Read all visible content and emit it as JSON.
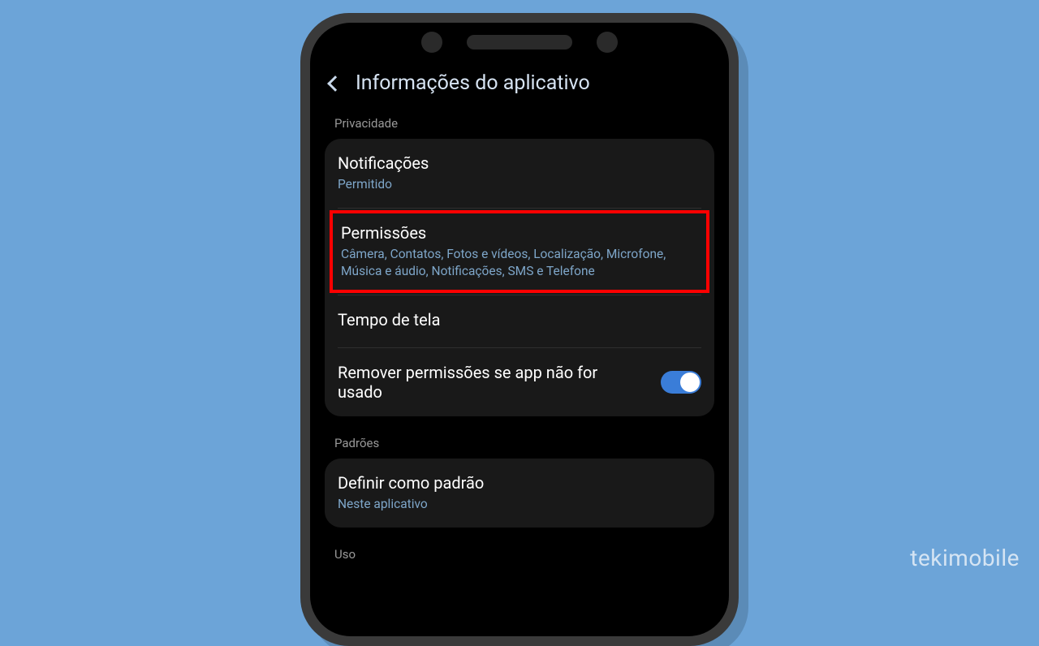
{
  "header": {
    "title": "Informações do aplicativo"
  },
  "sections": {
    "privacy_label": "Privacidade",
    "defaults_label": "Padrões",
    "usage_label": "Uso"
  },
  "rows": {
    "notifications": {
      "title": "Notificações",
      "sub": "Permitido"
    },
    "permissions": {
      "title": "Permissões",
      "sub": "Câmera, Contatos, Fotos e vídeos, Localização, Microfone, Música e áudio, Notificações, SMS e Telefone"
    },
    "screen_time": {
      "title": "Tempo de tela"
    },
    "remove_perms": {
      "title": "Remover permissões se app não for usado",
      "toggle_on": true
    },
    "set_default": {
      "title": "Definir como padrão",
      "sub": "Neste aplicativo"
    }
  },
  "watermark": "tekimobile"
}
